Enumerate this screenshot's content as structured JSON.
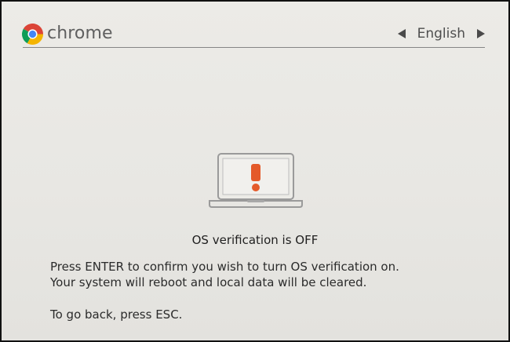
{
  "header": {
    "brand_name": "chrome",
    "language": "English",
    "logo_icon": "chrome-logo-icon",
    "previous_icon": "left-triangle-icon",
    "next_icon": "right-triangle-icon"
  },
  "main": {
    "illustration_icon": "laptop-exclamation-icon",
    "headline": "OS verification is OFF",
    "instructions": [
      "Press ENTER to confirm you wish to turn OS verification on.",
      "Your system will reboot and local data will be cleared.",
      "To go back, press ESC."
    ]
  },
  "colors": {
    "background": "#ECEBE7",
    "text": "#2B2B2B",
    "muted_text": "#5F5F5F",
    "alert_orange": "#E45A2A",
    "laptop_outline": "#9A9A9A"
  }
}
